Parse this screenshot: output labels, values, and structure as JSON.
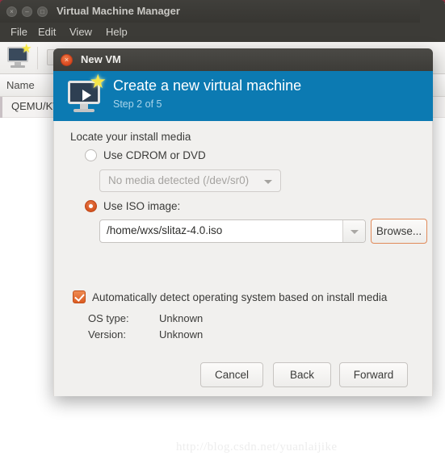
{
  "background_window": {
    "title": "Virtual Machine Manager",
    "window_buttons": [
      {
        "name": "close",
        "glyph": "×"
      },
      {
        "name": "minimize",
        "glyph": "‒"
      },
      {
        "name": "maximize",
        "glyph": "□"
      }
    ],
    "menu": [
      "File",
      "Edit",
      "View",
      "Help"
    ],
    "toolbar": {
      "new_vm_icon": "new-vm-icon",
      "second_icon": "open-vm-icon"
    },
    "list": {
      "columns": [
        "Name"
      ],
      "rows": [
        {
          "name": "QEMU/KVM"
        }
      ]
    }
  },
  "dialog": {
    "window_title": "New VM",
    "close_glyph": "×",
    "banner": {
      "title": "Create a new virtual machine",
      "step": "Step 2 of 5",
      "icon": "new-vm-banner-icon",
      "color": "#0c7ab2"
    },
    "section_label": "Locate your install media",
    "options": {
      "cdrom": {
        "label": "Use CDROM or DVD",
        "selected": false,
        "combo_value": "No media detected (/dev/sr0)"
      },
      "iso": {
        "label": "Use ISO image:",
        "selected": true,
        "path_value": "/home/wxs/slitaz-4.0.iso",
        "browse_label": "Browse..."
      }
    },
    "autodetect": {
      "label": "Automatically detect operating system based on install media",
      "checked": true
    },
    "os_info": [
      {
        "key": "OS type:",
        "value": "Unknown"
      },
      {
        "key": "Version:",
        "value": "Unknown"
      }
    ],
    "actions": {
      "cancel": "Cancel",
      "back": "Back",
      "forward": "Forward"
    },
    "accent_color": "#dc5c22"
  },
  "watermark": "http://blog.csdn.net/yuanlaijike"
}
